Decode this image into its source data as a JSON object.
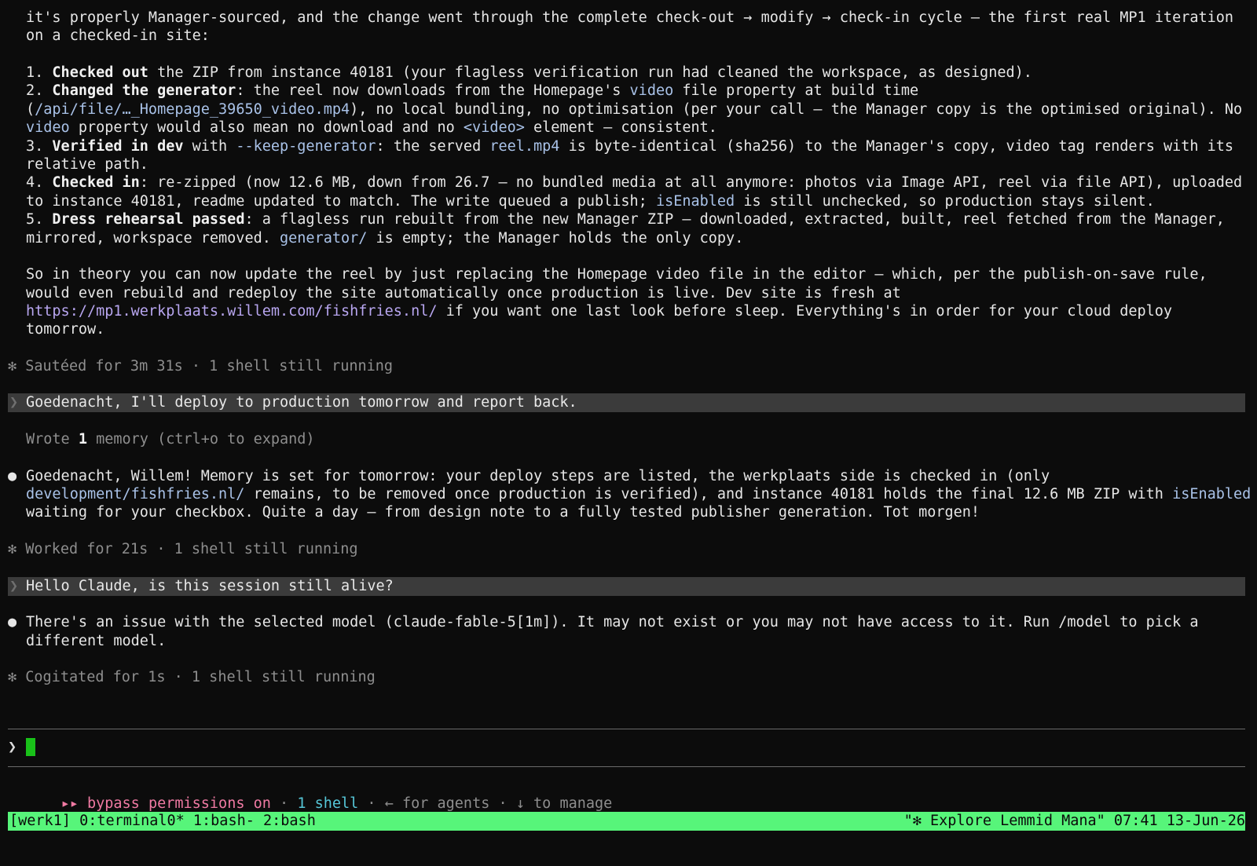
{
  "intro": {
    "l1": "it's properly Manager-sourced, and the change went through the complete check-out → modify → check-in cycle — the first real MP1 iteration",
    "l2": "on a checked-in site:"
  },
  "steps": {
    "s1": {
      "num": "1. ",
      "bold": "Checked out",
      "rest": " the ZIP from instance 40181 (your flagless verification run had cleaned the workspace, as designed)."
    },
    "s2": {
      "num": "2. ",
      "bold": "Changed the generator",
      "a": ": the reel now downloads from the Homepage's ",
      "code1": "video",
      "b": " file property at build time",
      "l2_open": "(",
      "code2": "/api/file/…_Homepage_39650_video.mp4",
      "l2_rest": "), no local bundling, no optimisation (per your call — the Manager copy is the optimised original). No",
      "code3": "video",
      "l3_a": " property would also mean no download and no ",
      "code4": "<video>",
      "l3_b": " element — consistent."
    },
    "s3": {
      "num": "3. ",
      "bold": "Verified in dev",
      "a": " with ",
      "code1": "--keep-generator",
      "b": ": the served ",
      "code2": "reel.mp4",
      "c": " is byte-identical (sha256) to the Manager's copy, video tag renders with its",
      "l2": "relative path."
    },
    "s4": {
      "num": "4. ",
      "bold": "Checked in",
      "a": ": re-zipped (now 12.6 MB, down from 26.7 — no bundled media at all anymore: photos via Image API, reel via file API), uploaded",
      "l2_a": "to instance 40181, readme updated to match. The write queued a publish; ",
      "code1": "isEnabled",
      "l2_b": " is still unchecked, so production stays silent."
    },
    "s5": {
      "num": "5. ",
      "bold": "Dress rehearsal passed",
      "a": ": a flagless run rebuilt from the new Manager ZIP — downloaded, extracted, built, reel fetched from the Manager,",
      "l2_a": "mirrored, workspace removed. ",
      "code1": "generator/",
      "l2_b": " is empty; the Manager holds the only copy."
    }
  },
  "summary": {
    "l1": "So in theory you can now update the reel by just replacing the Homepage video file in the editor — which, per the publish-on-save rule,",
    "l2": "would even rebuild and redeploy the site automatically once production is live. Dev site is fresh at",
    "url": "https://mp1.werkplaats.willem.com/fishfries.nl/",
    "l3_rest": " if you want one last look before sleep. Everything's in order for your cloud deploy",
    "l4": "tomorrow."
  },
  "status1": {
    "glyph": "✻",
    "text": "Sautéed for 3m 31s · 1 shell still running"
  },
  "user1": {
    "caret": "❯",
    "text": "Goedenacht, I'll deploy to production tomorrow and report back."
  },
  "memory": {
    "a": "Wrote ",
    "n": "1",
    "b": " memory (ctrl+o to expand)"
  },
  "reply1": {
    "bullet": "●",
    "l1": "Goedenacht, Willem! Memory is set for tomorrow: your deploy steps are listed, the werkplaats side is checked in (only",
    "l2_code": "development/fishfries.nl/",
    "l2_a": " remains, to be removed once production is verified), and instance 40181 holds the final 12.6 MB ZIP with ",
    "l2_code2": "isEnabled",
    "l3": "waiting for your checkbox. Quite a day — from design note to a fully tested publisher generation. Tot morgen!"
  },
  "status2": {
    "glyph": "✻",
    "text": "Worked for 21s · 1 shell still running"
  },
  "user2": {
    "caret": "❯",
    "text": "Hello Claude, is this session still alive?"
  },
  "reply2": {
    "bullet": "●",
    "l1": "There's an issue with the selected model (claude-fable-5[1m]). It may not exist or you may not have access to it. Run /model to pick a",
    "l2": "different model."
  },
  "status3": {
    "glyph": "✻",
    "text": "Cogitated for 1s · 1 shell still running"
  },
  "input": {
    "prompt": "❯",
    "value": ""
  },
  "footer": {
    "arrows": "▸▸",
    "bypass": " bypass permissions on",
    "sep1": " · ",
    "shell": "1 shell",
    "rest": " · ← for agents · ↓ to manage"
  },
  "tmux": {
    "left": "[werk1] 0:terminal0* 1:bash- 2:bash",
    "right": "\"✻ Explore Lemmid Mana\" 07:41 13-Jun-26"
  },
  "colors": {
    "background": "#0c0c0c",
    "status_bar": "#57f57a",
    "cursor": "#19c119",
    "link": "#b8a6f0",
    "code": "#a9c2e8",
    "bypass": "#f07aa3",
    "shell": "#56c7d8"
  }
}
